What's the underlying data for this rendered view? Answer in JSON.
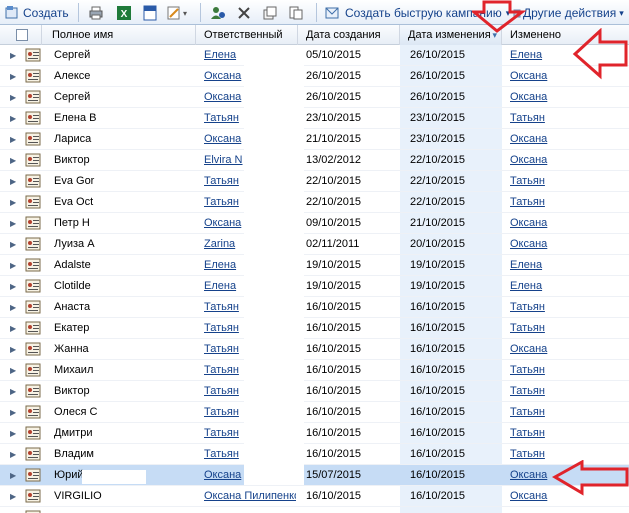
{
  "toolbar": {
    "create_label": "Создать",
    "campaign_label": "Создать быструю кампанию",
    "campaign_chevron": "▾",
    "more_label": "Другие действия",
    "more_chevron": "▾",
    "icons": [
      "new-record-icon",
      "print-icon",
      "excel-icon",
      "word-icon",
      "mail-merge-icon",
      "assign-icon",
      "delete-icon",
      "copy-icon",
      "share-icon",
      "campaign-icon",
      "actions-icon"
    ]
  },
  "columns": {
    "full_name": "Полное имя",
    "owner": "Ответственный",
    "created": "Дата создания",
    "modified": "Дата изменения",
    "modified_by": "Изменено",
    "sort_indicator": "▾"
  },
  "rows": [
    {
      "name": "Сергей",
      "owner": "Елена",
      "created": "05/10/2015",
      "modified": "26/10/2015",
      "modified_by": "Елена"
    },
    {
      "name": "Алексе",
      "owner": "Оксана",
      "created": "26/10/2015",
      "modified": "26/10/2015",
      "modified_by": "Оксана"
    },
    {
      "name": "Сергей",
      "owner": "Оксана",
      "created": "26/10/2015",
      "modified": "26/10/2015",
      "modified_by": "Оксана"
    },
    {
      "name": "Елена В",
      "owner": "Татьян",
      "created": "23/10/2015",
      "modified": "23/10/2015",
      "modified_by": "Татьян"
    },
    {
      "name": "Лариса",
      "owner": "Оксана",
      "created": "21/10/2015",
      "modified": "23/10/2015",
      "modified_by": "Оксана"
    },
    {
      "name": "Виктор",
      "owner": "Elvira N",
      "created": "13/02/2012",
      "modified": "22/10/2015",
      "modified_by": "Оксана"
    },
    {
      "name": "Eva Gor",
      "owner": "Татьян",
      "created": "22/10/2015",
      "modified": "22/10/2015",
      "modified_by": "Татьян"
    },
    {
      "name": "Eva Oct",
      "owner": "Татьян",
      "created": "22/10/2015",
      "modified": "22/10/2015",
      "modified_by": "Татьян"
    },
    {
      "name": "Петр Н",
      "owner": "Оксана",
      "created": "09/10/2015",
      "modified": "21/10/2015",
      "modified_by": "Оксана"
    },
    {
      "name": "Луиза А",
      "owner": "Zarina",
      "created": "02/11/2011",
      "modified": "20/10/2015",
      "modified_by": "Оксана"
    },
    {
      "name": "Adalste",
      "owner": "Елена",
      "created": "19/10/2015",
      "modified": "19/10/2015",
      "modified_by": "Елена"
    },
    {
      "name": "Clotilde",
      "owner": "Елена",
      "created": "19/10/2015",
      "modified": "19/10/2015",
      "modified_by": "Елена"
    },
    {
      "name": "Анаста",
      "owner": "Татьян",
      "created": "16/10/2015",
      "modified": "16/10/2015",
      "modified_by": "Татьян"
    },
    {
      "name": "Екатер",
      "owner": "Татьян",
      "created": "16/10/2015",
      "modified": "16/10/2015",
      "modified_by": "Татьян"
    },
    {
      "name": "Жанна",
      "owner": "Татьян",
      "created": "16/10/2015",
      "modified": "16/10/2015",
      "modified_by": "Оксана"
    },
    {
      "name": "Михаил",
      "owner": "Татьян",
      "created": "16/10/2015",
      "modified": "16/10/2015",
      "modified_by": "Татьян"
    },
    {
      "name": "Виктор",
      "owner": "Татьян",
      "created": "16/10/2015",
      "modified": "16/10/2015",
      "modified_by": "Татьян"
    },
    {
      "name": "Олеся С",
      "owner": "Татьян",
      "created": "16/10/2015",
      "modified": "16/10/2015",
      "modified_by": "Татьян"
    },
    {
      "name": "Дмитри",
      "owner": "Татьян",
      "created": "16/10/2015",
      "modified": "16/10/2015",
      "modified_by": "Татьян"
    },
    {
      "name": "Владим",
      "owner": "Татьян",
      "created": "16/10/2015",
      "modified": "16/10/2015",
      "modified_by": "Татьян"
    },
    {
      "name": "Юрий",
      "owner": "Оксана",
      "created": "15/07/2015",
      "modified": "16/10/2015",
      "modified_by": "Оксана",
      "selected": true
    },
    {
      "name": "VIRGILIO",
      "owner": "Оксана Пилипенко",
      "created": "16/10/2015",
      "modified": "16/10/2015",
      "modified_by": "Оксана"
    },
    {
      "name": "",
      "owner": "",
      "created": "",
      "modified": "",
      "modified_by": ""
    }
  ],
  "colors": {
    "link": "#15428b",
    "selected_row": "#c6dcf5",
    "sorted_column": "#e8f1fb",
    "annotation_arrow": "#e0242b"
  }
}
